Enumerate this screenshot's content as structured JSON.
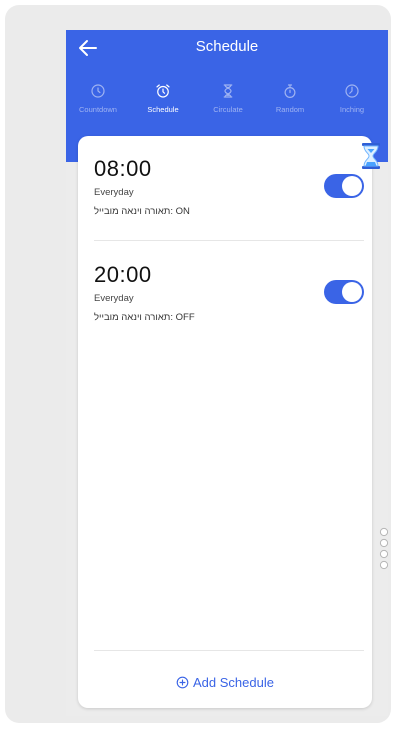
{
  "header": {
    "title": "Schedule"
  },
  "tabs": [
    {
      "label": "Countdown",
      "icon": "clock-icon",
      "active": false
    },
    {
      "label": "Schedule",
      "icon": "alarm-clock-icon",
      "active": true
    },
    {
      "label": "Circulate",
      "icon": "hourglass-icon",
      "active": false
    },
    {
      "label": "Random",
      "icon": "stopwatch-icon",
      "active": false
    },
    {
      "label": "Inching",
      "icon": "timer-icon",
      "active": false
    }
  ],
  "schedules": [
    {
      "time": "08:00",
      "repeat": "Everyday",
      "action": "תאורה וינאה מובייל: ON",
      "enabled": true
    },
    {
      "time": "20:00",
      "repeat": "Everyday",
      "action": "תאורה וינאה מובייל: OFF",
      "enabled": true
    }
  ],
  "add_schedule_label": "Add Schedule",
  "colors": {
    "accent": "#3a64e6",
    "tab_inactive": "#9fb3f2",
    "background": "#ececec"
  }
}
